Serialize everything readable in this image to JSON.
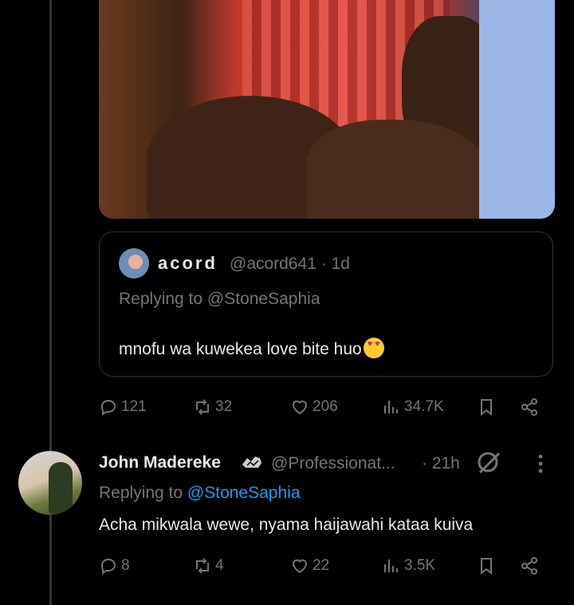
{
  "quoted": {
    "display_name": "acord",
    "handle": "@acord641",
    "age": "1d",
    "replying_prefix": "Replying to",
    "replying_to": "@StoneSaphia",
    "text": "mnofu wa kuwekea love bite huo",
    "emoji": "heart-eyes-emoji"
  },
  "post1_actions": {
    "replies": "121",
    "reposts": "32",
    "likes": "206",
    "views": "34.7K"
  },
  "reply": {
    "display_name": "John Madereke",
    "handle": "@Professionat...",
    "age": "21h",
    "replying_prefix": "Replying to",
    "replying_to": "@StoneSaphia",
    "text": "Acha mikwala wewe, nyama haijawahi kataa kuiva"
  },
  "post2_actions": {
    "replies": "8",
    "reposts": "4",
    "likes": "22",
    "views": "3.5K"
  },
  "colors": {
    "background": "#000000",
    "text": "#e7e9ea",
    "muted": "#71767b",
    "link": "#1d9bf0",
    "border": "#2f3336"
  },
  "icons": [
    "reply-icon",
    "repost-icon",
    "like-icon",
    "views-icon",
    "bookmark-icon",
    "share-icon",
    "grok-icon",
    "more-icon",
    "verified-badge-icon"
  ]
}
